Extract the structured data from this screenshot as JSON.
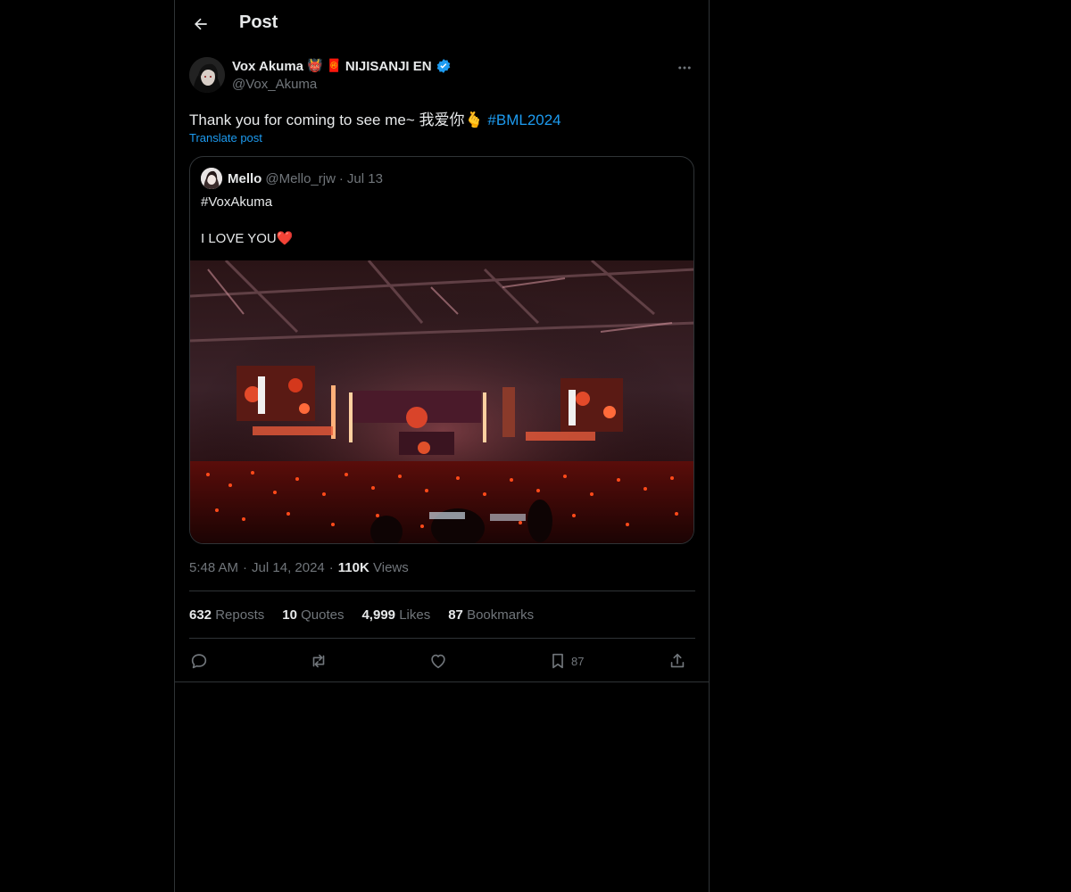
{
  "header": {
    "title": "Post"
  },
  "post": {
    "author": {
      "display_name": "Vox Akuma",
      "emoji_1": "👹",
      "emoji_2": "🧧",
      "display_suffix": "NIJISANJI EN",
      "handle": "@Vox_Akuma",
      "verified": true
    },
    "text": "Thank you for coming to see me~ 我爱你🫰",
    "hashtag": "#BML2024",
    "translate_label": "Translate post",
    "timestamp": {
      "time": "5:48 AM",
      "separator": "·",
      "date": "Jul 14, 2024",
      "views_count": "110K",
      "views_label": "Views"
    },
    "stats": {
      "reposts_count": "632",
      "reposts_label": "Reposts",
      "quotes_count": "10",
      "quotes_label": "Quotes",
      "likes_count": "4,999",
      "likes_label": "Likes",
      "bookmarks_count": "87",
      "bookmarks_label": "Bookmarks"
    },
    "actions": {
      "reply_icon": "reply-icon",
      "repost_icon": "repost-icon",
      "like_icon": "heart-icon",
      "bookmark_icon": "bookmark-icon",
      "bookmark_count": "87",
      "share_icon": "share-icon"
    }
  },
  "quote": {
    "name": "Mello",
    "handle": "@Mello_rjw",
    "separator": "·",
    "date": "Jul 13",
    "line1": "#VoxAkuma",
    "line2": "I LOVE YOU",
    "heart": "❤️"
  },
  "colors": {
    "background": "#000000",
    "text": "#e7e9ea",
    "muted": "#71767b",
    "accent": "#1d9bf0",
    "border": "#2f3336"
  }
}
